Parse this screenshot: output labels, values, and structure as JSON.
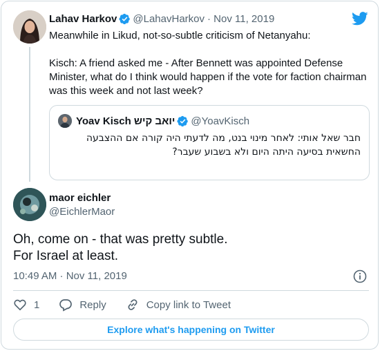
{
  "parent_tweet": {
    "author_name": "Lahav Harkov",
    "handle": "@LahavHarkov",
    "date": "· Nov 11, 2019",
    "paragraphs": [
      "Meanwhile in Likud, not-so-subtle criticism of Netanyahu:",
      "Kisch: A friend asked me - After Bennett was appointed Defense Minister, what do I think would happen if the vote for faction chairman was this week and not last week?"
    ]
  },
  "quoted_tweet": {
    "author_name": "Yoav Kisch יואב קיש",
    "handle": "@YoavKisch",
    "text": "חבר שאל אותי: לאחר מינוי בנט, מה לדעתי היה קורה אם ההצבעה החשאית בסיעה היתה היום ולא בשבוע שעבר?"
  },
  "main_tweet": {
    "author_name": "maor eichler",
    "handle": "@EichlerMaor",
    "text_lines": [
      "Oh, come on - that was pretty subtle.",
      "For Israel at least."
    ],
    "timestamp": "10:49 AM · Nov 11, 2019"
  },
  "actions": {
    "like_count": "1",
    "reply_label": "Reply",
    "copy_link_label": "Copy link to Tweet"
  },
  "explore_button": {
    "label": "Explore what's happening on Twitter"
  },
  "icons": {
    "brand": "twitter-bird-icon",
    "verified": "verified-badge-icon",
    "info": "info-icon",
    "like": "heart-icon",
    "reply": "reply-bubble-icon",
    "copy_link": "link-icon"
  },
  "colors": {
    "accent": "#1d9bf0",
    "text": "#0f1419",
    "secondary_text": "#536471",
    "border": "#cfd9de"
  }
}
